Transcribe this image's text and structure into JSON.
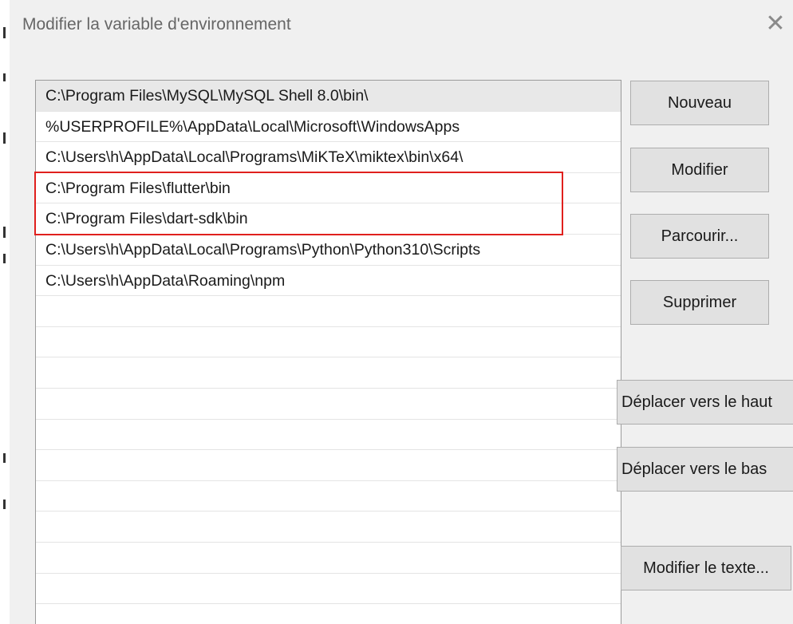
{
  "dialog": {
    "title": "Modifier la variable d'environnement",
    "close_symbol": "✕"
  },
  "paths": [
    "C:\\Program Files\\MySQL\\MySQL Shell 8.0\\bin\\",
    "%USERPROFILE%\\AppData\\Local\\Microsoft\\WindowsApps",
    "C:\\Users\\h\\AppData\\Local\\Programs\\MiKTeX\\miktex\\bin\\x64\\",
    "C:\\Program Files\\flutter\\bin",
    "C:\\Program Files\\dart-sdk\\bin",
    "C:\\Users\\h\\AppData\\Local\\Programs\\Python\\Python310\\Scripts",
    "C:\\Users\\h\\AppData\\Roaming\\npm",
    "",
    "",
    "",
    "",
    "",
    "",
    "",
    "",
    "",
    "",
    ""
  ],
  "buttons": {
    "new": "Nouveau",
    "edit": "Modifier",
    "browse": "Parcourir...",
    "delete": "Supprimer",
    "move_up": "Déplacer vers le haut",
    "move_down": "Déplacer vers le bas",
    "edit_text": "Modifier le texte..."
  },
  "colors": {
    "highlight": "#e0201d",
    "selected_row": "#e8e8e8"
  }
}
